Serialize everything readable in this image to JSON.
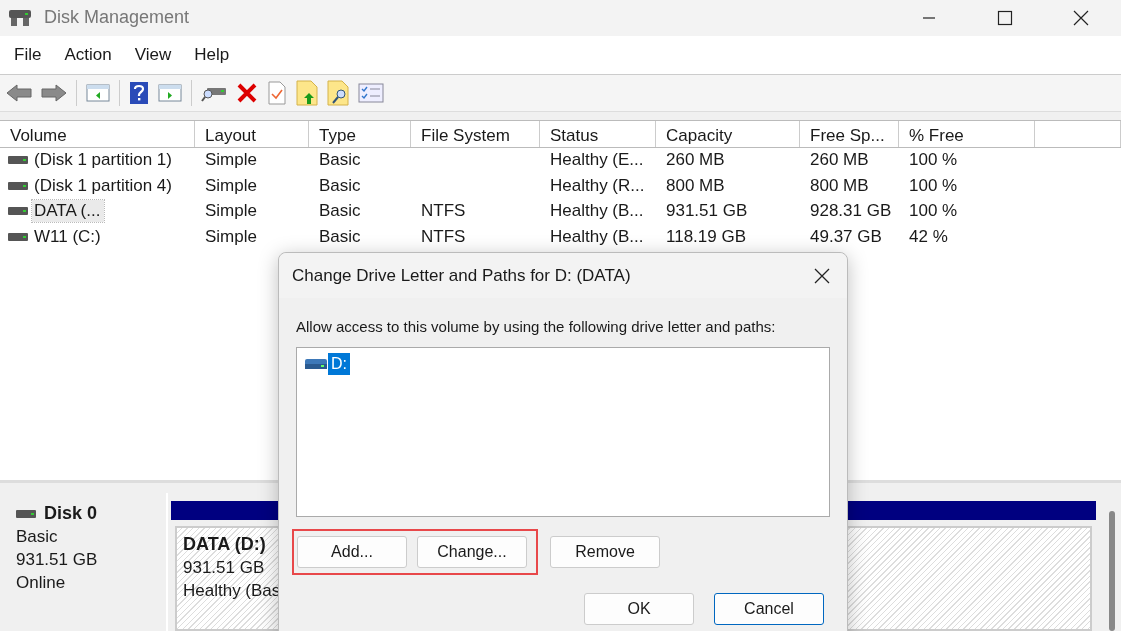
{
  "window": {
    "title": "Disk Management"
  },
  "menu": [
    "File",
    "Action",
    "View",
    "Help"
  ],
  "table": {
    "columns": [
      "Volume",
      "Layout",
      "Type",
      "File System",
      "Status",
      "Capacity",
      "Free Sp...",
      "% Free"
    ],
    "rows": [
      {
        "cells": [
          "(Disk 1 partition 1)",
          "Simple",
          "Basic",
          "",
          "Healthy (E...",
          "260 MB",
          "260 MB",
          "100 %"
        ],
        "selected": false
      },
      {
        "cells": [
          "(Disk 1 partition 4)",
          "Simple",
          "Basic",
          "",
          "Healthy (R...",
          "800 MB",
          "800 MB",
          "100 %"
        ],
        "selected": false
      },
      {
        "cells": [
          "DATA (...",
          "Simple",
          "Basic",
          "NTFS",
          "Healthy (B...",
          "931.51 GB",
          "928.31 GB",
          "100 %"
        ],
        "selected": true
      },
      {
        "cells": [
          "W11 (C:)",
          "Simple",
          "Basic",
          "NTFS",
          "Healthy (B...",
          "118.19 GB",
          "49.37 GB",
          "42 %"
        ],
        "selected": false
      }
    ]
  },
  "disk": {
    "name": "Disk 0",
    "type": "Basic",
    "size": "931.51 GB",
    "status": "Online"
  },
  "partition": {
    "name": "DATA  (D:)",
    "size": "931.51 GB",
    "status": "Healthy (Bas"
  },
  "dialog": {
    "title": "Change Drive Letter and Paths for D: (DATA)",
    "description": "Allow access to this volume by using the following drive letter and paths:",
    "paths": [
      {
        "label": "D:",
        "selected": true
      }
    ],
    "framed_buttons": [
      "Add...",
      "Change..."
    ],
    "buttons": [
      "Remove"
    ],
    "footer_buttons": [
      {
        "label": "OK",
        "default": false
      },
      {
        "label": "Cancel",
        "default": true
      }
    ]
  }
}
